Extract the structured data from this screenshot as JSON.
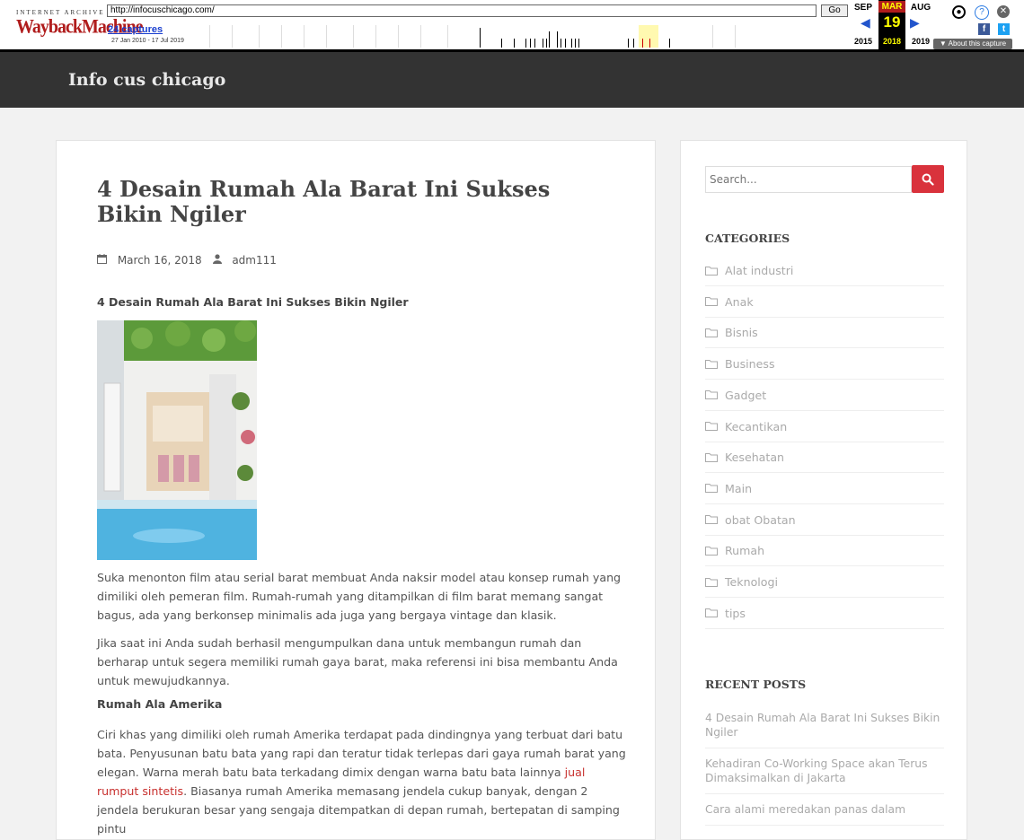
{
  "wayback": {
    "logo_top": "INTERNET ARCHIVE",
    "logo_main": "WaybackMachine",
    "url": "http://infocuschicago.com/",
    "go_label": "Go",
    "captures_label": "24 captures",
    "date_range": "27 Jan 2010 - 17 Jul 2019",
    "months": {
      "prev": "SEP",
      "current": "MAR",
      "next": "AUG"
    },
    "day": "19",
    "years": {
      "prev": "2015",
      "current": "2018",
      "next": "2019"
    },
    "about_label": "▼ About this capture"
  },
  "site": {
    "title": "Info cus chicago"
  },
  "post": {
    "title": "4 Desain Rumah Ala Barat Ini Sukses Bikin Ngiler",
    "date": "March 16, 2018",
    "author": "adm111",
    "subheading": "4 Desain Rumah Ala Barat Ini Sukses Bikin Ngiler",
    "para1": "Suka menonton film atau serial barat membuat Anda naksir model atau konsep rumah yang dimiliki oleh pemeran film. Rumah-rumah yang ditampilkan di film barat memang sangat bagus, ada yang berkonsep minimalis ada juga yang bergaya vintage dan klasik.",
    "para2": "Jika saat ini Anda sudah berhasil mengumpulkan dana untuk membangun rumah dan berharap untuk segera memiliki rumah gaya barat, maka referensi ini bisa membantu Anda untuk mewujudkannya.",
    "heading_amerika": "Rumah Ala Amerika",
    "para3_before": "Ciri khas yang dimiliki oleh rumah Amerika terdapat pada dindingnya yang terbuat dari batu bata. Penyusunan batu bata yang rapi dan teratur tidak terlepas dari gaya rumah barat yang elegan. Warna merah batu bata terkadang dimix dengan warna batu bata lainnya ",
    "para3_link": "jual rumput sintetis",
    "para3_after": ". Biasanya rumah Amerika memasang jendela cukup banyak, dengan 2 jendela berukuran besar yang sengaja ditempatkan di depan rumah, bertepatan di samping pintu"
  },
  "sidebar": {
    "search_placeholder": "Search...",
    "categories_title": "CATEGORIES",
    "categories": [
      "Alat industri",
      "Anak",
      "Bisnis",
      "Business",
      "Gadget",
      "Kecantikan",
      "Kesehatan",
      "Main",
      "obat Obatan",
      "Rumah",
      "Teknologi",
      "tips"
    ],
    "recent_title": "RECENT POSTS",
    "recent_posts": [
      "4 Desain Rumah Ala Barat Ini Sukses Bikin Ngiler",
      "Kehadiran Co-Working Space akan Terus Dimaksimalkan di Jakarta",
      "Cara alami meredakan panas dalam"
    ]
  },
  "colors": {
    "accent": "#d9323c",
    "header_bg": "#333333",
    "link": "#c8312f"
  }
}
